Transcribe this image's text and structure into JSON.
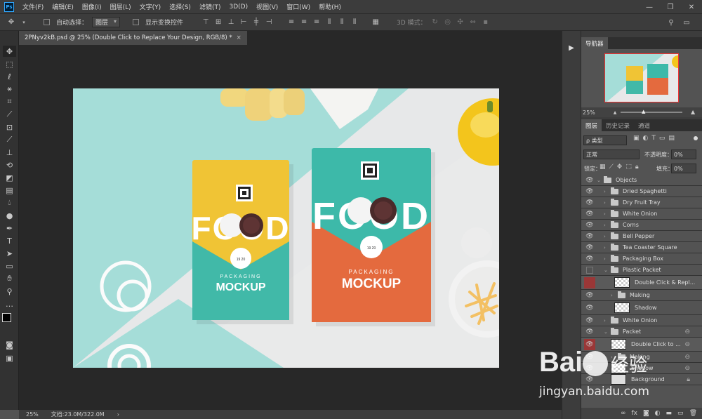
{
  "menubar": {
    "logo": "Ps",
    "items": [
      "文件(F)",
      "编辑(E)",
      "图像(I)",
      "图层(L)",
      "文字(Y)",
      "选择(S)",
      "滤镜(T)",
      "3D(D)",
      "视图(V)",
      "窗口(W)",
      "帮助(H)"
    ],
    "win_min": "—",
    "win_max": "❐",
    "win_close": "✕"
  },
  "options": {
    "auto_select_label": "自动选择：",
    "auto_select_value": "图层",
    "show_transform_label": "显示变换控件",
    "mode_3d_label": "3D 模式："
  },
  "document_tab": {
    "title": "2PNyv2kB.psd @ 25% (Double Click to Replace Your Design, RGB/8) *",
    "close": "×"
  },
  "status": {
    "zoom": "25%",
    "doc_size": "文档:23.0M/322.0M",
    "arrow": "›"
  },
  "canvas_art": {
    "pack_left": {
      "brand": "FOOD",
      "line1": "PACKAGING",
      "line2": "MOCKUP",
      "badge": "19  20",
      "colors": {
        "top": "#f2c232",
        "bottom": "#3bb9a9"
      }
    },
    "pack_right": {
      "brand": "FOOD",
      "line1": "PACKAGING",
      "line2": "MOCKUP",
      "badge": "19  20",
      "colors": {
        "top": "#3bb9a9",
        "bottom": "#e26a3d"
      }
    },
    "bg_colors": {
      "mint": "#a3dcd7",
      "light": "#e6e7e8"
    }
  },
  "navigator": {
    "tab": "导航器",
    "zoom": "25%"
  },
  "layers_panel": {
    "tabs": [
      "图层",
      "历史记录",
      "通道"
    ],
    "filter_label": "ρ 类型",
    "blend_mode": "正常",
    "opacity_label": "不透明度：",
    "opacity_value": "0%",
    "lock_label": "锁定：",
    "fill_label": "填充：",
    "fill_value": "0%",
    "layers": [
      {
        "name": "Objects",
        "type": "group",
        "indent": 0,
        "visible": true,
        "expanded": true
      },
      {
        "name": "Dried Spaghetti",
        "type": "group",
        "indent": 1,
        "visible": true
      },
      {
        "name": "Dry Fruit Tray",
        "type": "group",
        "indent": 1,
        "visible": true
      },
      {
        "name": "White Onion",
        "type": "group",
        "indent": 1,
        "visible": true
      },
      {
        "name": "Corns",
        "type": "group",
        "indent": 1,
        "visible": true
      },
      {
        "name": "Bell Pepper",
        "type": "group",
        "indent": 1,
        "visible": true
      },
      {
        "name": "Tea Coaster Square",
        "type": "group",
        "indent": 1,
        "visible": true
      },
      {
        "name": "Packaging Box",
        "type": "group",
        "indent": 1,
        "visible": true
      },
      {
        "name": "Plastic Packet",
        "type": "group",
        "indent": 1,
        "visible": false,
        "expanded": true
      },
      {
        "name": "Double Click & Repl...",
        "type": "smart",
        "indent": 2,
        "visible": false,
        "selected": true
      },
      {
        "name": "Making",
        "type": "group",
        "indent": 2,
        "visible": true
      },
      {
        "name": "Shadow",
        "type": "raster",
        "indent": 2,
        "visible": true
      },
      {
        "name": "White Onion",
        "type": "group",
        "indent": 0,
        "visible": true
      },
      {
        "name": "Packet",
        "type": "group",
        "indent": 0,
        "visible": true,
        "expanded": true,
        "linked": true
      },
      {
        "name": "Double Click to ...",
        "type": "smart",
        "indent": 1,
        "visible": true,
        "selected": true,
        "linked": true
      },
      {
        "name": "Making",
        "type": "group",
        "indent": 1,
        "visible": true,
        "linked": true
      },
      {
        "name": "Shadow",
        "type": "raster",
        "indent": 1,
        "visible": true,
        "linked": true
      },
      {
        "name": "Background",
        "type": "raster",
        "indent": 0,
        "visible": true,
        "locked": true
      }
    ],
    "footer_icons": [
      "link-icon",
      "fx-icon",
      "mask-icon",
      "adjustment-icon",
      "group-icon",
      "new-layer-icon",
      "trash-icon"
    ]
  },
  "watermark": {
    "brand": "Bai",
    "suffix": "经验",
    "url": "jingyan.baidu.com"
  }
}
